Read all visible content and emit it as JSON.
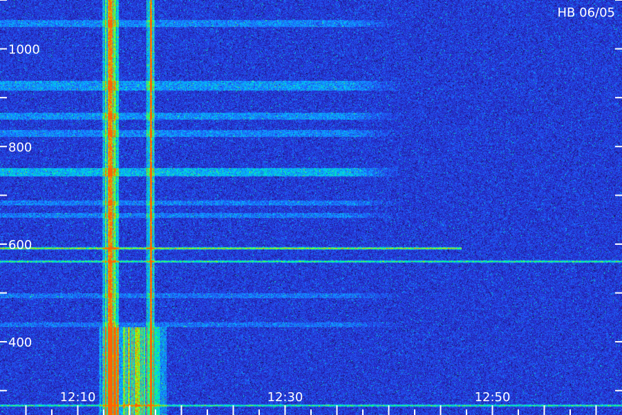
{
  "chart_data": {
    "type": "heatmap",
    "title": "HB 06/05",
    "xlabel": "",
    "ylabel": "",
    "x_tick_labels": [
      "12:10",
      "12:30",
      "12:50"
    ],
    "x_tick_values_min": [
      10,
      30,
      50
    ],
    "x_range_min": [
      2.5,
      62.5
    ],
    "y_tick_labels": [
      "400",
      "600",
      "800",
      "1000"
    ],
    "y_tick_values": [
      400,
      600,
      800,
      1000
    ],
    "y_range": [
      250,
      1100
    ],
    "colormap": [
      "#000000",
      "#1a1060",
      "#2828c8",
      "#1e64ff",
      "#00c8ff",
      "#00ff80",
      "#b4ff00",
      "#ff6400"
    ],
    "background_color": "#0a0640",
    "axis_text_color": "#ffffff",
    "bursts": [
      {
        "t_start_min": 12.3,
        "t_end_min": 13.9,
        "f_low": 250,
        "f_high": 1100,
        "intensity": 0.85
      },
      {
        "t_start_min": 16.6,
        "t_end_min": 17.4,
        "f_low": 250,
        "f_high": 1100,
        "intensity": 0.95
      },
      {
        "t_start_min": 12.0,
        "t_end_min": 18.5,
        "f_low": 250,
        "f_high": 430,
        "intensity": 0.7
      }
    ],
    "tones": [
      {
        "freq": 592,
        "t_start_min": 2.5,
        "t_end_min": 47,
        "intensity": 0.75
      },
      {
        "freq": 565,
        "t_start_min": 2.5,
        "t_end_min": 62.5,
        "intensity": 0.55
      },
      {
        "freq": 270,
        "t_start_min": 2.5,
        "t_end_min": 62.5,
        "intensity": 0.5
      }
    ],
    "bands": [
      {
        "freq_low": 740,
        "freq_high": 757,
        "t_end_min": 36,
        "intensity": 0.7
      },
      {
        "freq_low": 915,
        "freq_high": 935,
        "t_end_min": 36,
        "intensity": 0.55
      },
      {
        "freq_low": 855,
        "freq_high": 870,
        "t_end_min": 36,
        "intensity": 0.5
      },
      {
        "freq_low": 820,
        "freq_high": 835,
        "t_end_min": 36,
        "intensity": 0.45
      },
      {
        "freq_low": 1045,
        "freq_high": 1060,
        "t_end_min": 36,
        "intensity": 0.45
      },
      {
        "freq_low": 680,
        "freq_high": 690,
        "t_end_min": 36,
        "intensity": 0.4
      },
      {
        "freq_low": 655,
        "freq_high": 665,
        "t_end_min": 36,
        "intensity": 0.4
      },
      {
        "freq_low": 490,
        "freq_high": 500,
        "t_end_min": 36,
        "intensity": 0.35
      },
      {
        "freq_low": 430,
        "freq_high": 440,
        "t_end_min": 36,
        "intensity": 0.35
      }
    ]
  }
}
